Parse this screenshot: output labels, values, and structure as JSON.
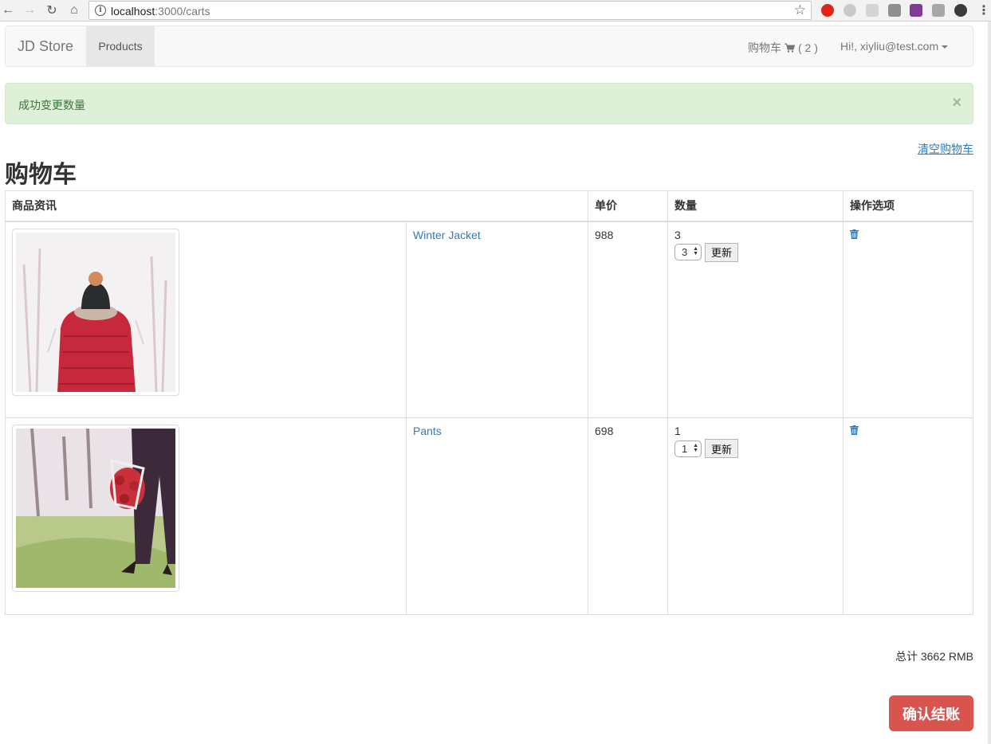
{
  "browser": {
    "url_host": "localhost",
    "url_rest": ":3000/carts"
  },
  "navbar": {
    "brand": "JD Store",
    "products": "Products",
    "cart_label": "购物车",
    "cart_count": "( 2 )",
    "user": "Hi!, xiyliu@test.com"
  },
  "alert": {
    "message": "成功变更数量",
    "close": "×"
  },
  "clear_cart": "清空购物车",
  "title": "购物车",
  "table": {
    "headers": [
      "商品资讯",
      "单价",
      "数量",
      "操作选项"
    ],
    "rows": [
      {
        "name": "Winter Jacket",
        "price": "988",
        "quantity": "3",
        "select_value": "3",
        "update": "更新"
      },
      {
        "name": "Pants",
        "price": "698",
        "quantity": "1",
        "select_value": "1",
        "update": "更新"
      }
    ]
  },
  "total": "总计 3662 RMB",
  "checkout": "确认结账"
}
